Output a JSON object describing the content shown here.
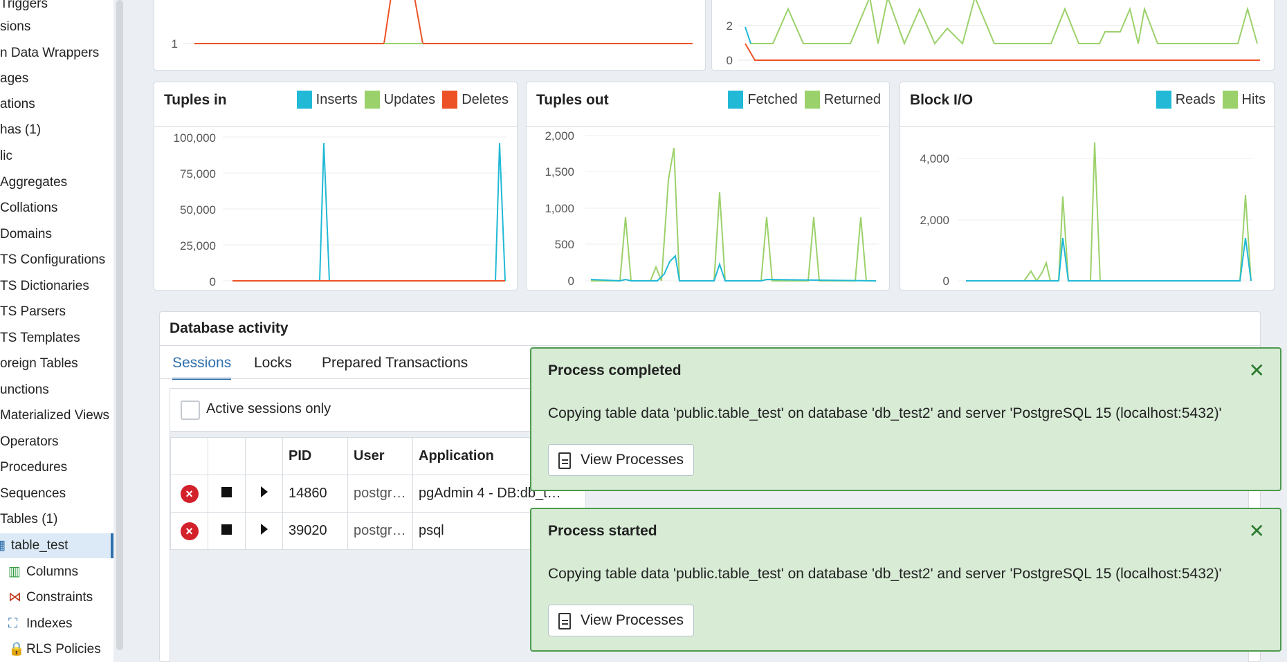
{
  "sidebar": {
    "items": [
      {
        "label": "Triggers",
        "top": -12,
        "indent": 0
      },
      {
        "label": "sions",
        "top": 21,
        "indent": 0
      },
      {
        "label": "n Data Wrappers",
        "top": 59,
        "indent": 0
      },
      {
        "label": "ages",
        "top": 96,
        "indent": 0
      },
      {
        "label": "ations",
        "top": 133,
        "indent": 0
      },
      {
        "label": "has (1)",
        "top": 170,
        "indent": 0
      },
      {
        "label": "lic",
        "top": 208,
        "indent": 0
      },
      {
        "label": "Aggregates",
        "top": 246,
        "indent": 0
      },
      {
        "label": "Collations",
        "top": 283,
        "indent": 0
      },
      {
        "label": "Domains",
        "top": 321,
        "indent": 0
      },
      {
        "label": "TS Configurations",
        "top": 358,
        "indent": 0
      },
      {
        "label": "TS Dictionaries",
        "top": 396,
        "indent": 0
      },
      {
        "label": "TS Parsers",
        "top": 433,
        "indent": 0
      },
      {
        "label": "TS Templates",
        "top": 471,
        "indent": 0
      },
      {
        "label": "oreign Tables",
        "top": 508,
        "indent": 0
      },
      {
        "label": "unctions",
        "top": 546,
        "indent": 0
      },
      {
        "label": "Materialized Views",
        "top": 583,
        "indent": 0
      },
      {
        "label": "Operators",
        "top": 621,
        "indent": 0
      },
      {
        "label": "Procedures",
        "top": 658,
        "indent": 0
      },
      {
        "label": "Sequences",
        "top": 696,
        "indent": 0
      },
      {
        "label": "Tables (1)",
        "top": 733,
        "indent": 0
      },
      {
        "label": "table_test",
        "top": 771,
        "indent": 14,
        "selected": true,
        "icon": "table-icon"
      },
      {
        "label": "Columns",
        "top": 809,
        "indent": 40,
        "icon": "columns-icon"
      },
      {
        "label": "Constraints",
        "top": 846,
        "indent": 40,
        "icon": "constraints-icon"
      },
      {
        "label": "Indexes",
        "top": 884,
        "indent": 40,
        "icon": "indexes-icon"
      },
      {
        "label": "RLS Policies",
        "top": 921,
        "indent": 40,
        "icon": "rls-policies-icon"
      }
    ]
  },
  "colors": {
    "cyan": "#21b9d6",
    "green": "#9bd16a",
    "orange": "#ec5225",
    "accent": "#2f6fad",
    "toast_bg": "#d7ebd5",
    "toast_border": "#4c9a4e",
    "danger": "#d3212c"
  },
  "charts": {
    "top_left": {
      "ytick": "1"
    },
    "top_right": {
      "yticks": [
        "2",
        "0"
      ]
    },
    "tuples_in": {
      "title": "Tuples in",
      "legend": [
        {
          "label": "Inserts",
          "color": "#21b9d6"
        },
        {
          "label": "Updates",
          "color": "#9bd16a"
        },
        {
          "label": "Deletes",
          "color": "#ec5225"
        }
      ],
      "yticks": [
        "100,000",
        "75,000",
        "50,000",
        "25,000",
        "0"
      ]
    },
    "tuples_out": {
      "title": "Tuples out",
      "legend": [
        {
          "label": "Fetched",
          "color": "#21b9d6"
        },
        {
          "label": "Returned",
          "color": "#9bd16a"
        }
      ],
      "yticks": [
        "2,000",
        "1,500",
        "1,000",
        "500",
        "0"
      ]
    },
    "block_io": {
      "title": "Block I/O",
      "legend": [
        {
          "label": "Reads",
          "color": "#21b9d6"
        },
        {
          "label": "Hits",
          "color": "#9bd16a"
        }
      ],
      "yticks": [
        "4,000",
        "2,000",
        "0"
      ]
    }
  },
  "activity": {
    "title": "Database activity",
    "tabs": [
      "Sessions",
      "Locks",
      "Prepared Transactions"
    ],
    "active_tab": "Sessions",
    "active_sessions_label": "Active sessions only",
    "columns": [
      "",
      "",
      "",
      "PID",
      "User",
      "Application"
    ],
    "rows": [
      {
        "pid": "14860",
        "user": "postgr…",
        "application": "pgAdmin 4 - DB:db_t…"
      },
      {
        "pid": "39020",
        "user": "postgr…",
        "application": "psql"
      }
    ]
  },
  "toasts": [
    {
      "title": "Process completed",
      "message": "Copying table data 'public.table_test' on database 'db_test2' and server 'PostgreSQL 15 (localhost:5432)'",
      "button": "View Processes"
    },
    {
      "title": "Process started",
      "message": "Copying table data 'public.table_test' on database 'db_test2' and server 'PostgreSQL 15 (localhost:5432)'",
      "button": "View Processes"
    }
  ]
}
